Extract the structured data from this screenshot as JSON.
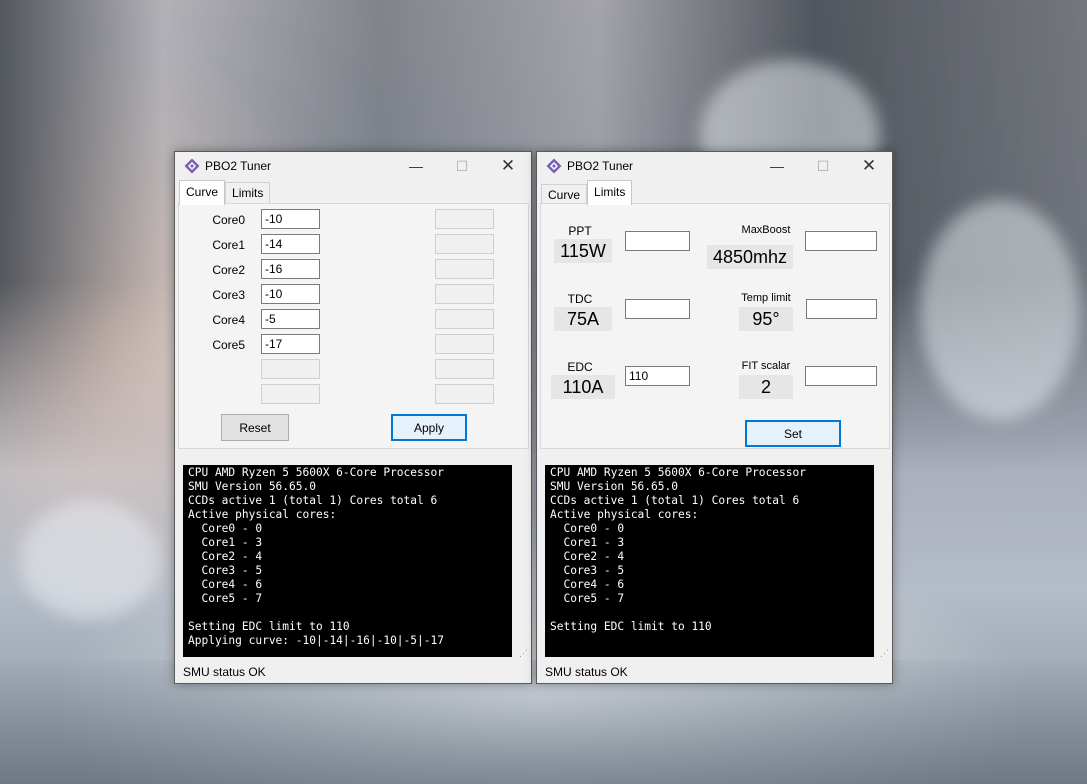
{
  "windows": {
    "left": {
      "title": "PBO2 Tuner",
      "tabs": [
        {
          "label": "Curve"
        },
        {
          "label": "Limits"
        }
      ],
      "active_tab": "Curve",
      "cores": [
        {
          "label": "Core0",
          "value": "-10"
        },
        {
          "label": "Core1",
          "value": "-14"
        },
        {
          "label": "Core2",
          "value": "-16"
        },
        {
          "label": "Core3",
          "value": "-10"
        },
        {
          "label": "Core4",
          "value": "-5"
        },
        {
          "label": "Core5",
          "value": "-17"
        }
      ],
      "reset_label": "Reset",
      "apply_label": "Apply",
      "console": "CPU AMD Ryzen 5 5600X 6-Core Processor\nSMU Version 56.65.0\nCCDs active 1 (total 1) Cores total 6\nActive physical cores:\n  Core0 - 0\n  Core1 - 3\n  Core2 - 4\n  Core3 - 5\n  Core4 - 6\n  Core5 - 7\n\nSetting EDC limit to 110\nApplying curve: -10|-14|-16|-10|-5|-17",
      "status": "SMU status OK"
    },
    "right": {
      "title": "PBO2 Tuner",
      "tabs": [
        {
          "label": "Curve"
        },
        {
          "label": "Limits"
        }
      ],
      "active_tab": "Limits",
      "ppt": {
        "label": "PPT",
        "value": "115W",
        "input": ""
      },
      "tdc": {
        "label": "TDC",
        "value": "75A",
        "input": ""
      },
      "edc": {
        "label": "EDC",
        "value": "110A",
        "input": "110"
      },
      "maxboost": {
        "label": "MaxBoost",
        "value": "4850mhz",
        "input": ""
      },
      "templimit": {
        "label": "Temp limit",
        "value": "95°",
        "input": ""
      },
      "fitscalar": {
        "label": "FIT scalar",
        "value": "2",
        "input": ""
      },
      "set_label": "Set",
      "console": "CPU AMD Ryzen 5 5600X 6-Core Processor\nSMU Version 56.65.0\nCCDs active 1 (total 1) Cores total 6\nActive physical cores:\n  Core0 - 0\n  Core1 - 3\n  Core2 - 4\n  Core3 - 5\n  Core4 - 6\n  Core5 - 7\n\nSetting EDC limit to 110",
      "status": "SMU status OK"
    }
  },
  "icons": {
    "app": "diamond-app-icon",
    "minimize": "minimize-icon",
    "maximize": "maximize-icon",
    "close": "close-icon",
    "grip": "resize-grip-icon"
  },
  "colors": {
    "accent": "#0078d7",
    "console_bg": "#000000",
    "console_fg": "#ffffff",
    "app_icon": "#7b5fb3"
  }
}
